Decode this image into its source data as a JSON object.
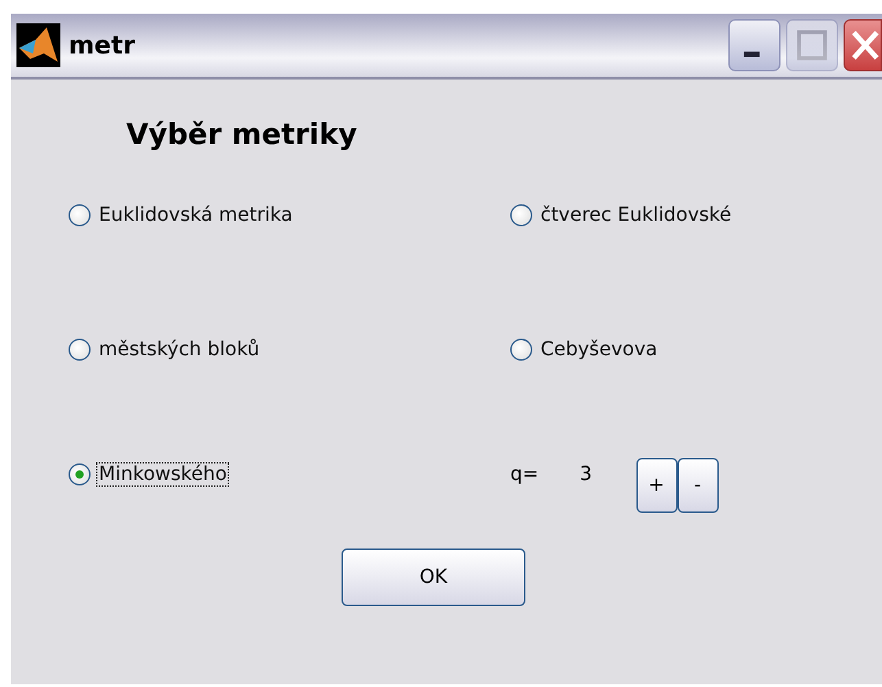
{
  "window": {
    "title": "metr"
  },
  "heading": "Výběr metriky",
  "options": [
    {
      "label": "Euklidovská metrika",
      "selected": false,
      "focused": false
    },
    {
      "label": "čtverec Euklidovské",
      "selected": false,
      "focused": false
    },
    {
      "label": "městských bloků",
      "selected": false,
      "focused": false
    },
    {
      "label": "Cebyševova",
      "selected": false,
      "focused": false
    },
    {
      "label": "Minkowského",
      "selected": true,
      "focused": true
    }
  ],
  "q": {
    "label": "q=",
    "value": "3",
    "buttons": [
      "+",
      "-"
    ]
  },
  "buttons": [
    "OK"
  ]
}
